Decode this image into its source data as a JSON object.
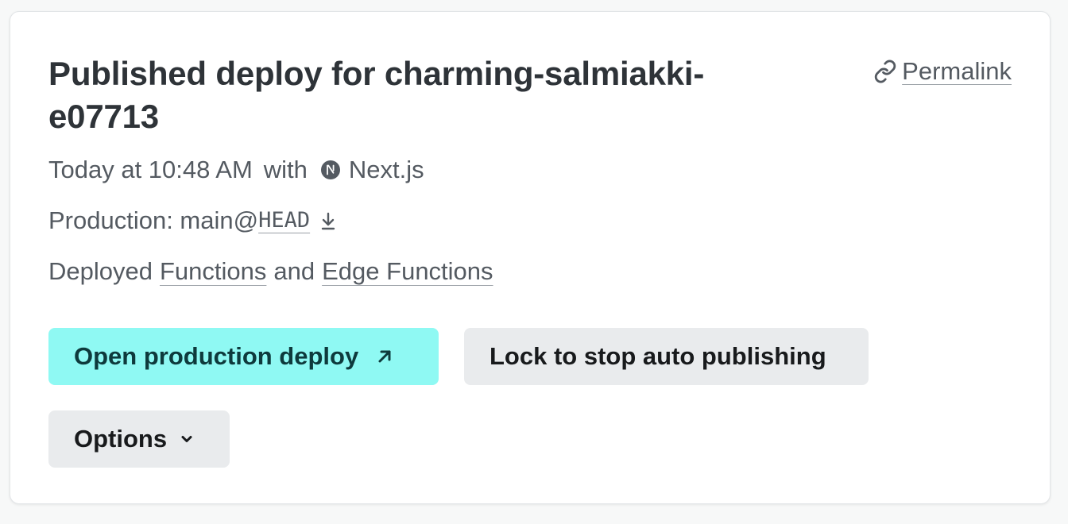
{
  "deploy": {
    "title": "Published deploy for charming-salmiakki-e07713",
    "permalink_label": "Permalink",
    "time_text": "Today at 10:48 AM",
    "with_text": "with",
    "framework": "Next.js",
    "framework_icon": "nextjs-icon",
    "production_prefix": "Production: main@",
    "commit_ref": "HEAD",
    "deployed_prefix": "Deployed",
    "functions_link": "Functions",
    "and_text": "and",
    "edge_functions_link": "Edge Functions"
  },
  "actions": {
    "open_label": "Open production deploy",
    "lock_label": "Lock to stop auto publishing",
    "options_label": "Options"
  },
  "colors": {
    "primary_button": "#8ff9f3",
    "primary_text": "#0e3a3c",
    "secondary_button": "#e9ebed",
    "muted_text": "#545a61",
    "heading_text": "#2e3338"
  }
}
